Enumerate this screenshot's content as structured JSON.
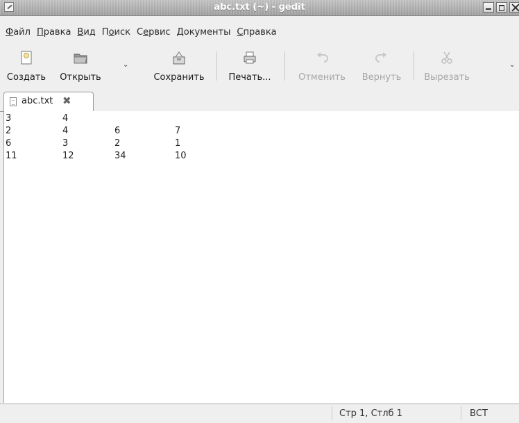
{
  "window": {
    "title": "abc.txt (~) - gedit"
  },
  "menu": {
    "items": [
      {
        "u": "Ф",
        "rest": "айл"
      },
      {
        "u": "П",
        "rest": "равка"
      },
      {
        "u": "В",
        "rest": "ид"
      },
      {
        "pre": "П",
        "u": "о",
        "rest": "иск"
      },
      {
        "pre": "С",
        "u": "е",
        "rest": "рвис"
      },
      {
        "u": "Д",
        "rest": "окументы"
      },
      {
        "u": "С",
        "rest": "правка"
      }
    ]
  },
  "toolbar": {
    "new_label": "Создать",
    "open_label": "Открыть",
    "save_label": "Сохранить",
    "print_label": "Печать...",
    "undo_label": "Отменить",
    "redo_label": "Вернуть",
    "cut_label": "Вырезать",
    "dropdown_glyph": "⌄",
    "overflow_glyph": "⌄"
  },
  "tab": {
    "label": "abc.txt",
    "close_glyph": "✖"
  },
  "editor": {
    "lines": [
      [
        "3",
        "4",
        "",
        ""
      ],
      [
        "2",
        "4",
        "6",
        "7"
      ],
      [
        "6",
        "3",
        "2",
        "1"
      ],
      [
        "11",
        "12",
        "34",
        "10"
      ]
    ]
  },
  "status": {
    "position": "Стр 1, Стлб 1",
    "mode": "ВСТ"
  },
  "colors": {
    "titlebar": "#a8a8a8",
    "disabled_text": "#a6a6a6",
    "background": "#efefef"
  }
}
